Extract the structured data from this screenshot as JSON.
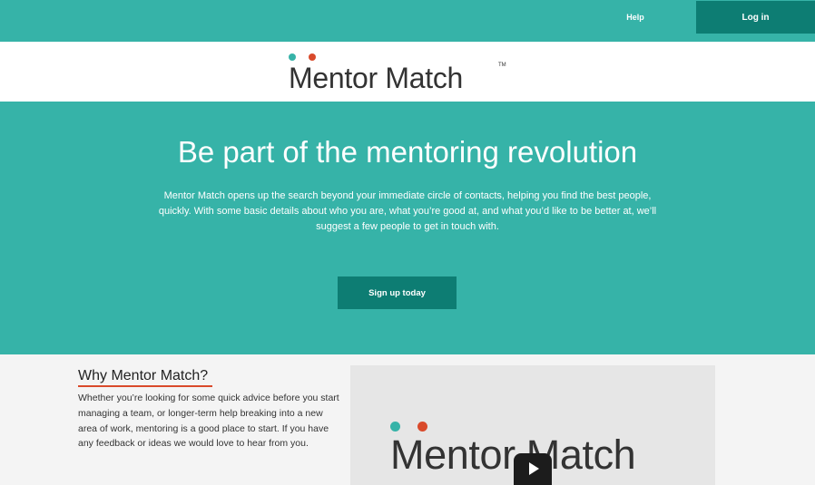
{
  "header": {
    "help_label": "Help",
    "login_label": "Log in",
    "background_color": "#36b3a8",
    "button_color": "#0d7d73"
  },
  "brand": {
    "logo_text": "Mentor Match",
    "trademark": "TM",
    "dot_colors": [
      "#36b3a8",
      "#d94a2b"
    ]
  },
  "hero": {
    "title": "Be part of the mentoring revolution",
    "description": "Mentor Match opens up the search beyond your immediate circle of contacts, helping you find the best people, quickly. With some basic details about who you are, what you’re good at, and what you’d like to be better at, we’ll suggest a few people to get in touch with.",
    "cta_label": "Sign up today"
  },
  "why": {
    "heading": "Why Mentor Match?",
    "body": "Whether you’re looking for some quick advice before you start managing a team, or longer-term help breaking into a new area of work, mentoring is a good place to start. If you have any feedback or ideas we would love to hear from you.",
    "underline_color": "#d94a2b"
  },
  "video": {
    "logo_text": "Mentor Match",
    "play_icon": "play-icon"
  }
}
